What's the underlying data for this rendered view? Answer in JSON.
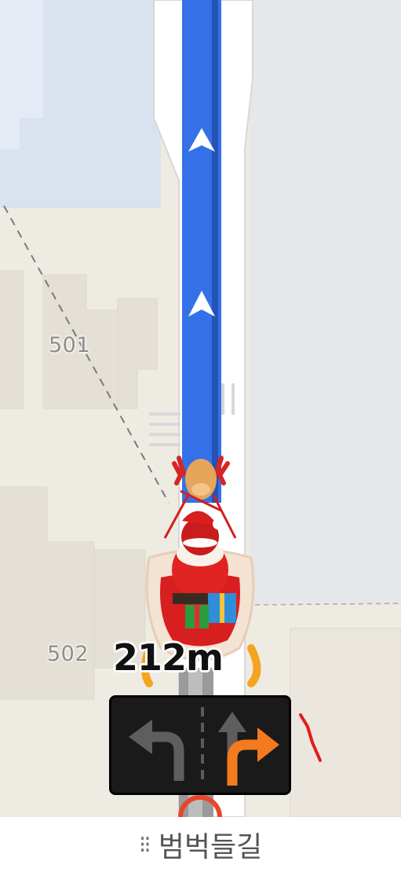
{
  "map": {
    "building_labels": [
      "501",
      "502"
    ],
    "route_color": "#3471e8",
    "map_background": "#eeebe3"
  },
  "navigation": {
    "distance": "212m",
    "vehicle_icon": "santa-sleigh-icon",
    "lanes": [
      {
        "direction": "left-turn",
        "active": false
      },
      {
        "direction": "straight-or-right-turn",
        "active": true
      }
    ],
    "active_color": "#f47a1f"
  },
  "bottom_bar": {
    "road_icon": "⁝⁝",
    "road_name": "범벅들길"
  }
}
